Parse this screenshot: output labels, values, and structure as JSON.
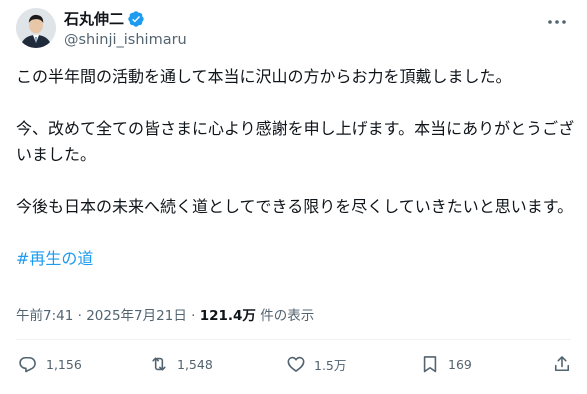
{
  "author": {
    "display_name": "石丸伸二",
    "handle": "@shinji_ishimaru"
  },
  "post": {
    "paragraphs": [
      "この半年間の活動を通して本当に沢山の方からお力を頂戴しました。",
      "今、改めて全ての皆さまに心より感謝を申し上げます。本当にありがとうございました。",
      "今後も日本の未来へ続く道としてできる限りを尽くしていきたいと思います。"
    ],
    "hashtag": "#再生の道"
  },
  "meta": {
    "time": "午前7:41",
    "separator": " · ",
    "date": "2025年7月21日",
    "views_count": "121.4万",
    "views_label": " 件の表示"
  },
  "actions": {
    "replies": "1,156",
    "reposts": "1,548",
    "likes": "1.5万",
    "bookmarks": "169"
  },
  "colors": {
    "accent": "#1d9bf0",
    "muted": "#536471",
    "text": "#0f1419"
  }
}
